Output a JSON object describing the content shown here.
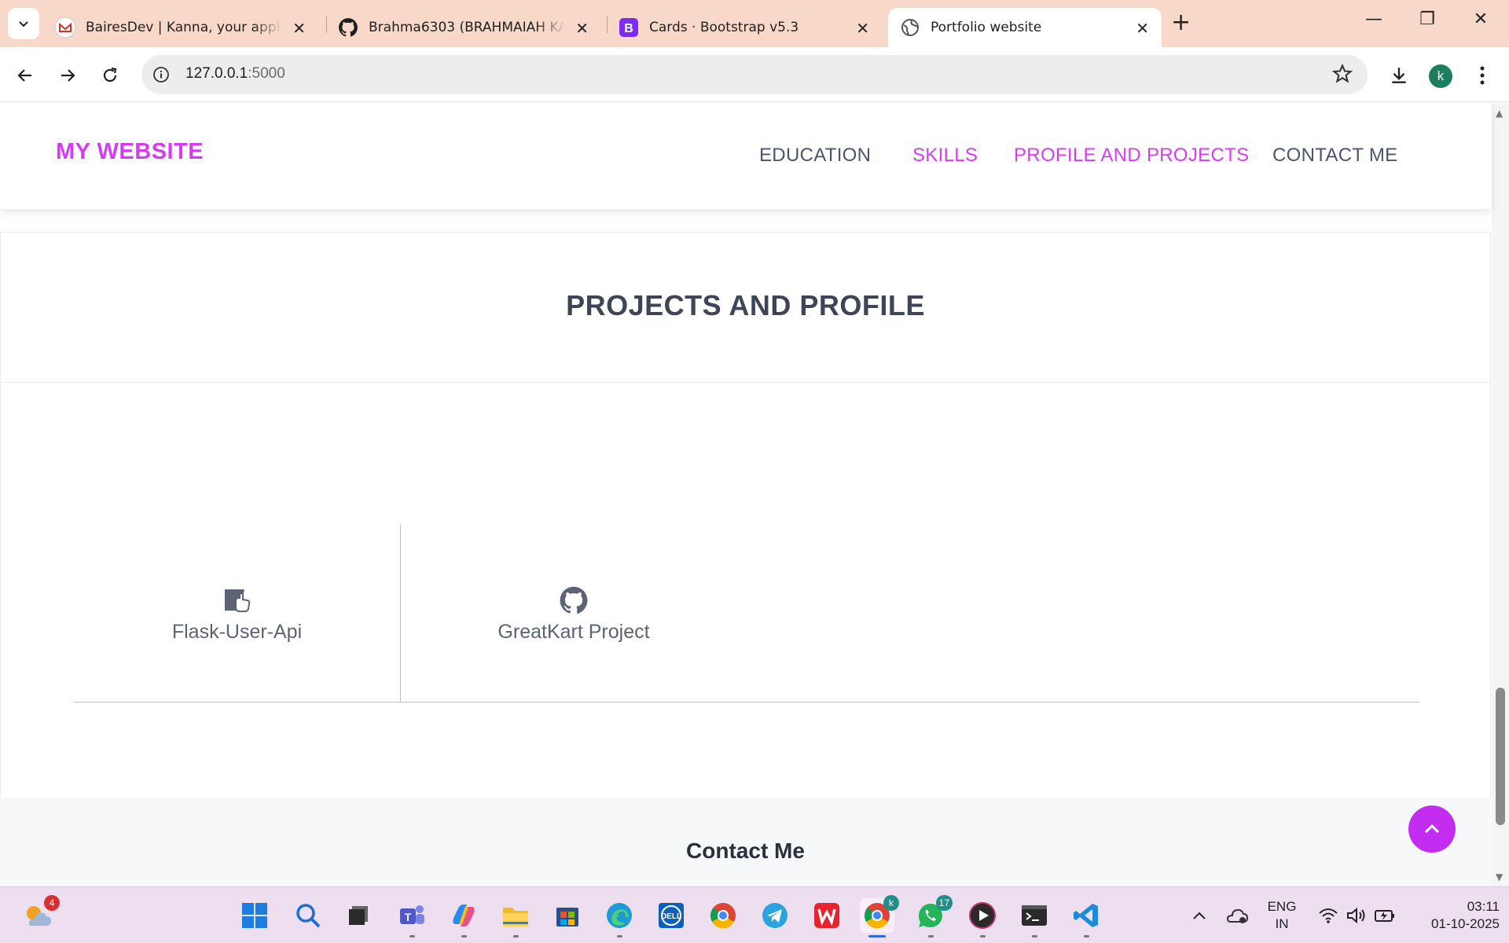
{
  "browser": {
    "tabs": [
      {
        "title": "BairesDev | Kanna, your applicat",
        "favicon": "gmail-icon"
      },
      {
        "title": "Brahma6303 (BRAHMAIAH KAN",
        "favicon": "github-icon"
      },
      {
        "title": "Cards · Bootstrap v5.3",
        "favicon": "bootstrap-icon"
      },
      {
        "title": "Portfolio website",
        "favicon": "globe-icon"
      }
    ],
    "url_host": "127.0.0.1",
    "url_port": ":5000",
    "profile_initial": "k"
  },
  "site": {
    "brand": "MY WEBSITE",
    "nav": [
      {
        "label": "EDUCATION",
        "active": false
      },
      {
        "label": "SKILLS",
        "active": true
      },
      {
        "label": "PROFILE AND PROJECTS",
        "active": true
      },
      {
        "label": "CONTACT ME",
        "active": false
      }
    ],
    "projects_title": "PROJECTS AND PROFILE",
    "projects": [
      {
        "label": "Flask-User-Api",
        "icon": "hand-point-icon"
      },
      {
        "label": "GreatKart Project",
        "icon": "github-icon"
      }
    ],
    "contact_title": "Contact Me",
    "accent_color": "#d63af2"
  },
  "taskbar": {
    "weather_badge": "4",
    "whatsapp_badge": "17",
    "chrome_profile_badge": "k",
    "language": "ENG",
    "region": "IN",
    "time": "03:11",
    "date": "01-10-2025"
  }
}
